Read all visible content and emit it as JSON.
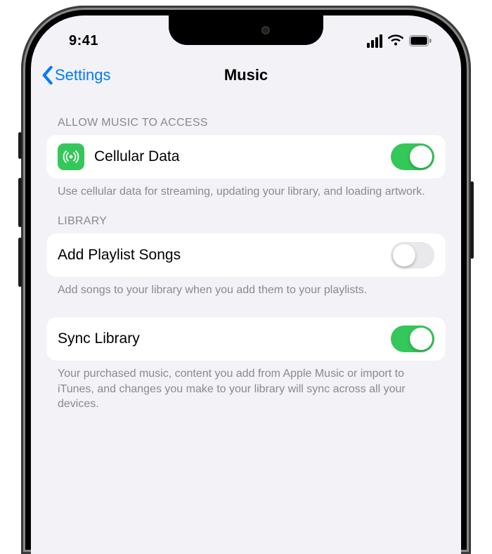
{
  "status": {
    "time": "9:41"
  },
  "nav": {
    "back_label": "Settings",
    "title": "Music"
  },
  "sections": {
    "access": {
      "header": "ALLOW MUSIC TO ACCESS",
      "cellular": {
        "label": "Cellular Data",
        "on": true
      },
      "footer": "Use cellular data for streaming, updating your library, and loading artwork."
    },
    "library": {
      "header": "LIBRARY",
      "add_songs": {
        "label": "Add Playlist Songs",
        "on": false
      },
      "add_songs_footer": "Add songs to your library when you add them to your playlists.",
      "sync": {
        "label": "Sync Library",
        "on": true
      },
      "sync_footer": "Your purchased music, content you add from Apple Music or import to iTunes, and changes you make to your library will sync across all your devices."
    }
  }
}
